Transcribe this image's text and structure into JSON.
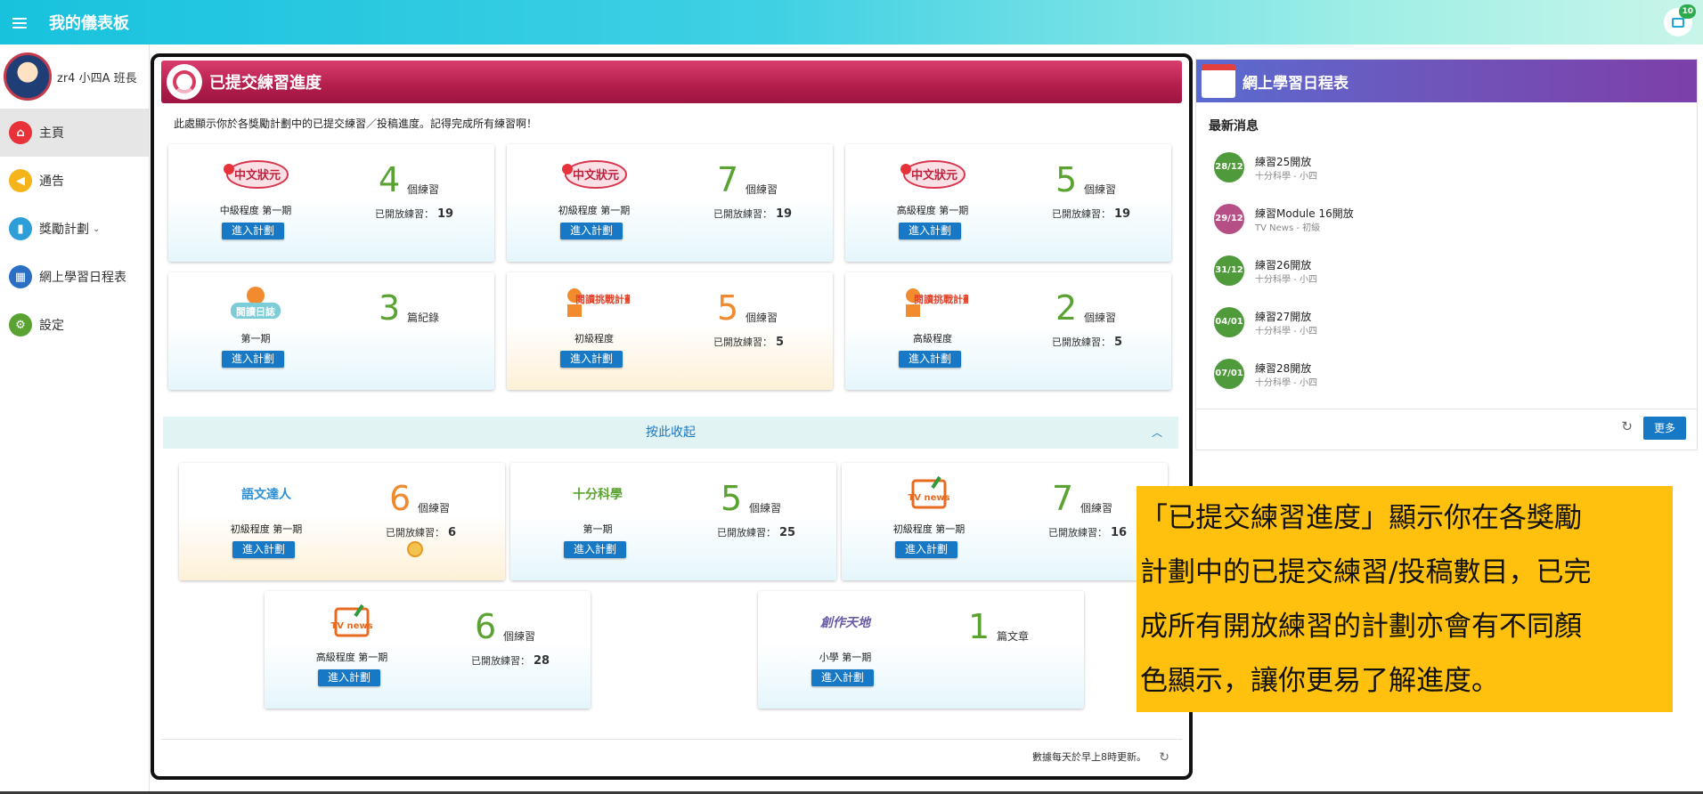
{
  "topbar": {
    "title": "我的儀表板",
    "notification_count": "10"
  },
  "sidebar": {
    "profile_name": "zr4 小四A 班長",
    "items": [
      {
        "label": "主頁",
        "icon": "home-icon",
        "color": "#e8323a"
      },
      {
        "label": "通告",
        "icon": "megaphone-icon",
        "color": "#f6b41b"
      },
      {
        "label": "獎勵計劃",
        "icon": "chart-icon",
        "color": "#2d9fd8",
        "caret": "⌄"
      },
      {
        "label": "網上學習日程表",
        "icon": "calendar-icon",
        "color": "#2a6fc4"
      },
      {
        "label": "設定",
        "icon": "gear-icon",
        "color": "#5aa332"
      }
    ]
  },
  "main": {
    "title": "已提交練習進度",
    "description": "此處顯示你於各獎勵計劃中的已提交練習／投稿進度。記得完成所有練習啊！",
    "enter_label": "進入計劃",
    "opened_label": "已開放練習：",
    "collapse_label": "按此收起",
    "footer_note": "數據每天於早上8時更新。",
    "cards": [
      {
        "logo": "中文狀元",
        "level": "中級程度 第一期",
        "count": "4",
        "unit": "個練習",
        "opened": "19"
      },
      {
        "logo": "中文狀元",
        "level": "初級程度 第一期",
        "count": "7",
        "unit": "個練習",
        "opened": "19"
      },
      {
        "logo": "中文狀元",
        "level": "高級程度 第一期",
        "count": "5",
        "unit": "個練習",
        "opened": "19"
      },
      {
        "logo": "閱讀日誌",
        "level": "第一期",
        "count": "3",
        "unit": "篇紀錄",
        "opened": ""
      },
      {
        "logo": "閱讀挑戰計劃",
        "level": "初級程度",
        "count": "5",
        "unit": "個練習",
        "opened": "5"
      },
      {
        "logo": "閱讀挑戰計劃",
        "level": "高級程度",
        "count": "2",
        "unit": "個練習",
        "opened": "5"
      },
      {
        "logo": "語文達人",
        "level": "初級程度 第一期",
        "count": "6",
        "unit": "個練習",
        "opened": "6"
      },
      {
        "logo": "十分科學",
        "level": "第一期",
        "count": "5",
        "unit": "個練習",
        "opened": "25"
      },
      {
        "logo": "TV news",
        "level": "初級程度 第一期",
        "count": "7",
        "unit": "個練習",
        "opened": "16"
      },
      {
        "logo": "TV news",
        "level": "高級程度 第一期",
        "count": "6",
        "unit": "個練習",
        "opened": "28"
      },
      {
        "logo": "創作天地",
        "level": "小學 第一期",
        "count": "1",
        "unit": "篇文章",
        "opened": ""
      }
    ]
  },
  "schedule": {
    "title": "網上學習日程表",
    "news_heading": "最新消息",
    "more_label": "更多",
    "items": [
      {
        "date": "28/12",
        "title": "練習25開放",
        "sub": "十分科學 - 小四",
        "color": "#4f9a3a"
      },
      {
        "date": "29/12",
        "title": "練習Module 16開放",
        "sub": "TV News - 初級",
        "color": "#b64f86"
      },
      {
        "date": "31/12",
        "title": "練習26開放",
        "sub": "十分科學 - 小四",
        "color": "#4f9a3a"
      },
      {
        "date": "04/01",
        "title": "練習27開放",
        "sub": "十分科學 - 小四",
        "color": "#4f9a3a"
      },
      {
        "date": "07/01",
        "title": "練習28開放",
        "sub": "十分科學 - 小四",
        "color": "#4f9a3a"
      }
    ]
  },
  "callout": {
    "line1": "「已提交練習進度」顯示你在各獎勵",
    "line2": "計劃中的已提交練習/投稿數目，已完",
    "line3": "成所有開放練習的計劃亦會有不同顏",
    "line4": "色顯示，讓你更易了解進度。"
  }
}
